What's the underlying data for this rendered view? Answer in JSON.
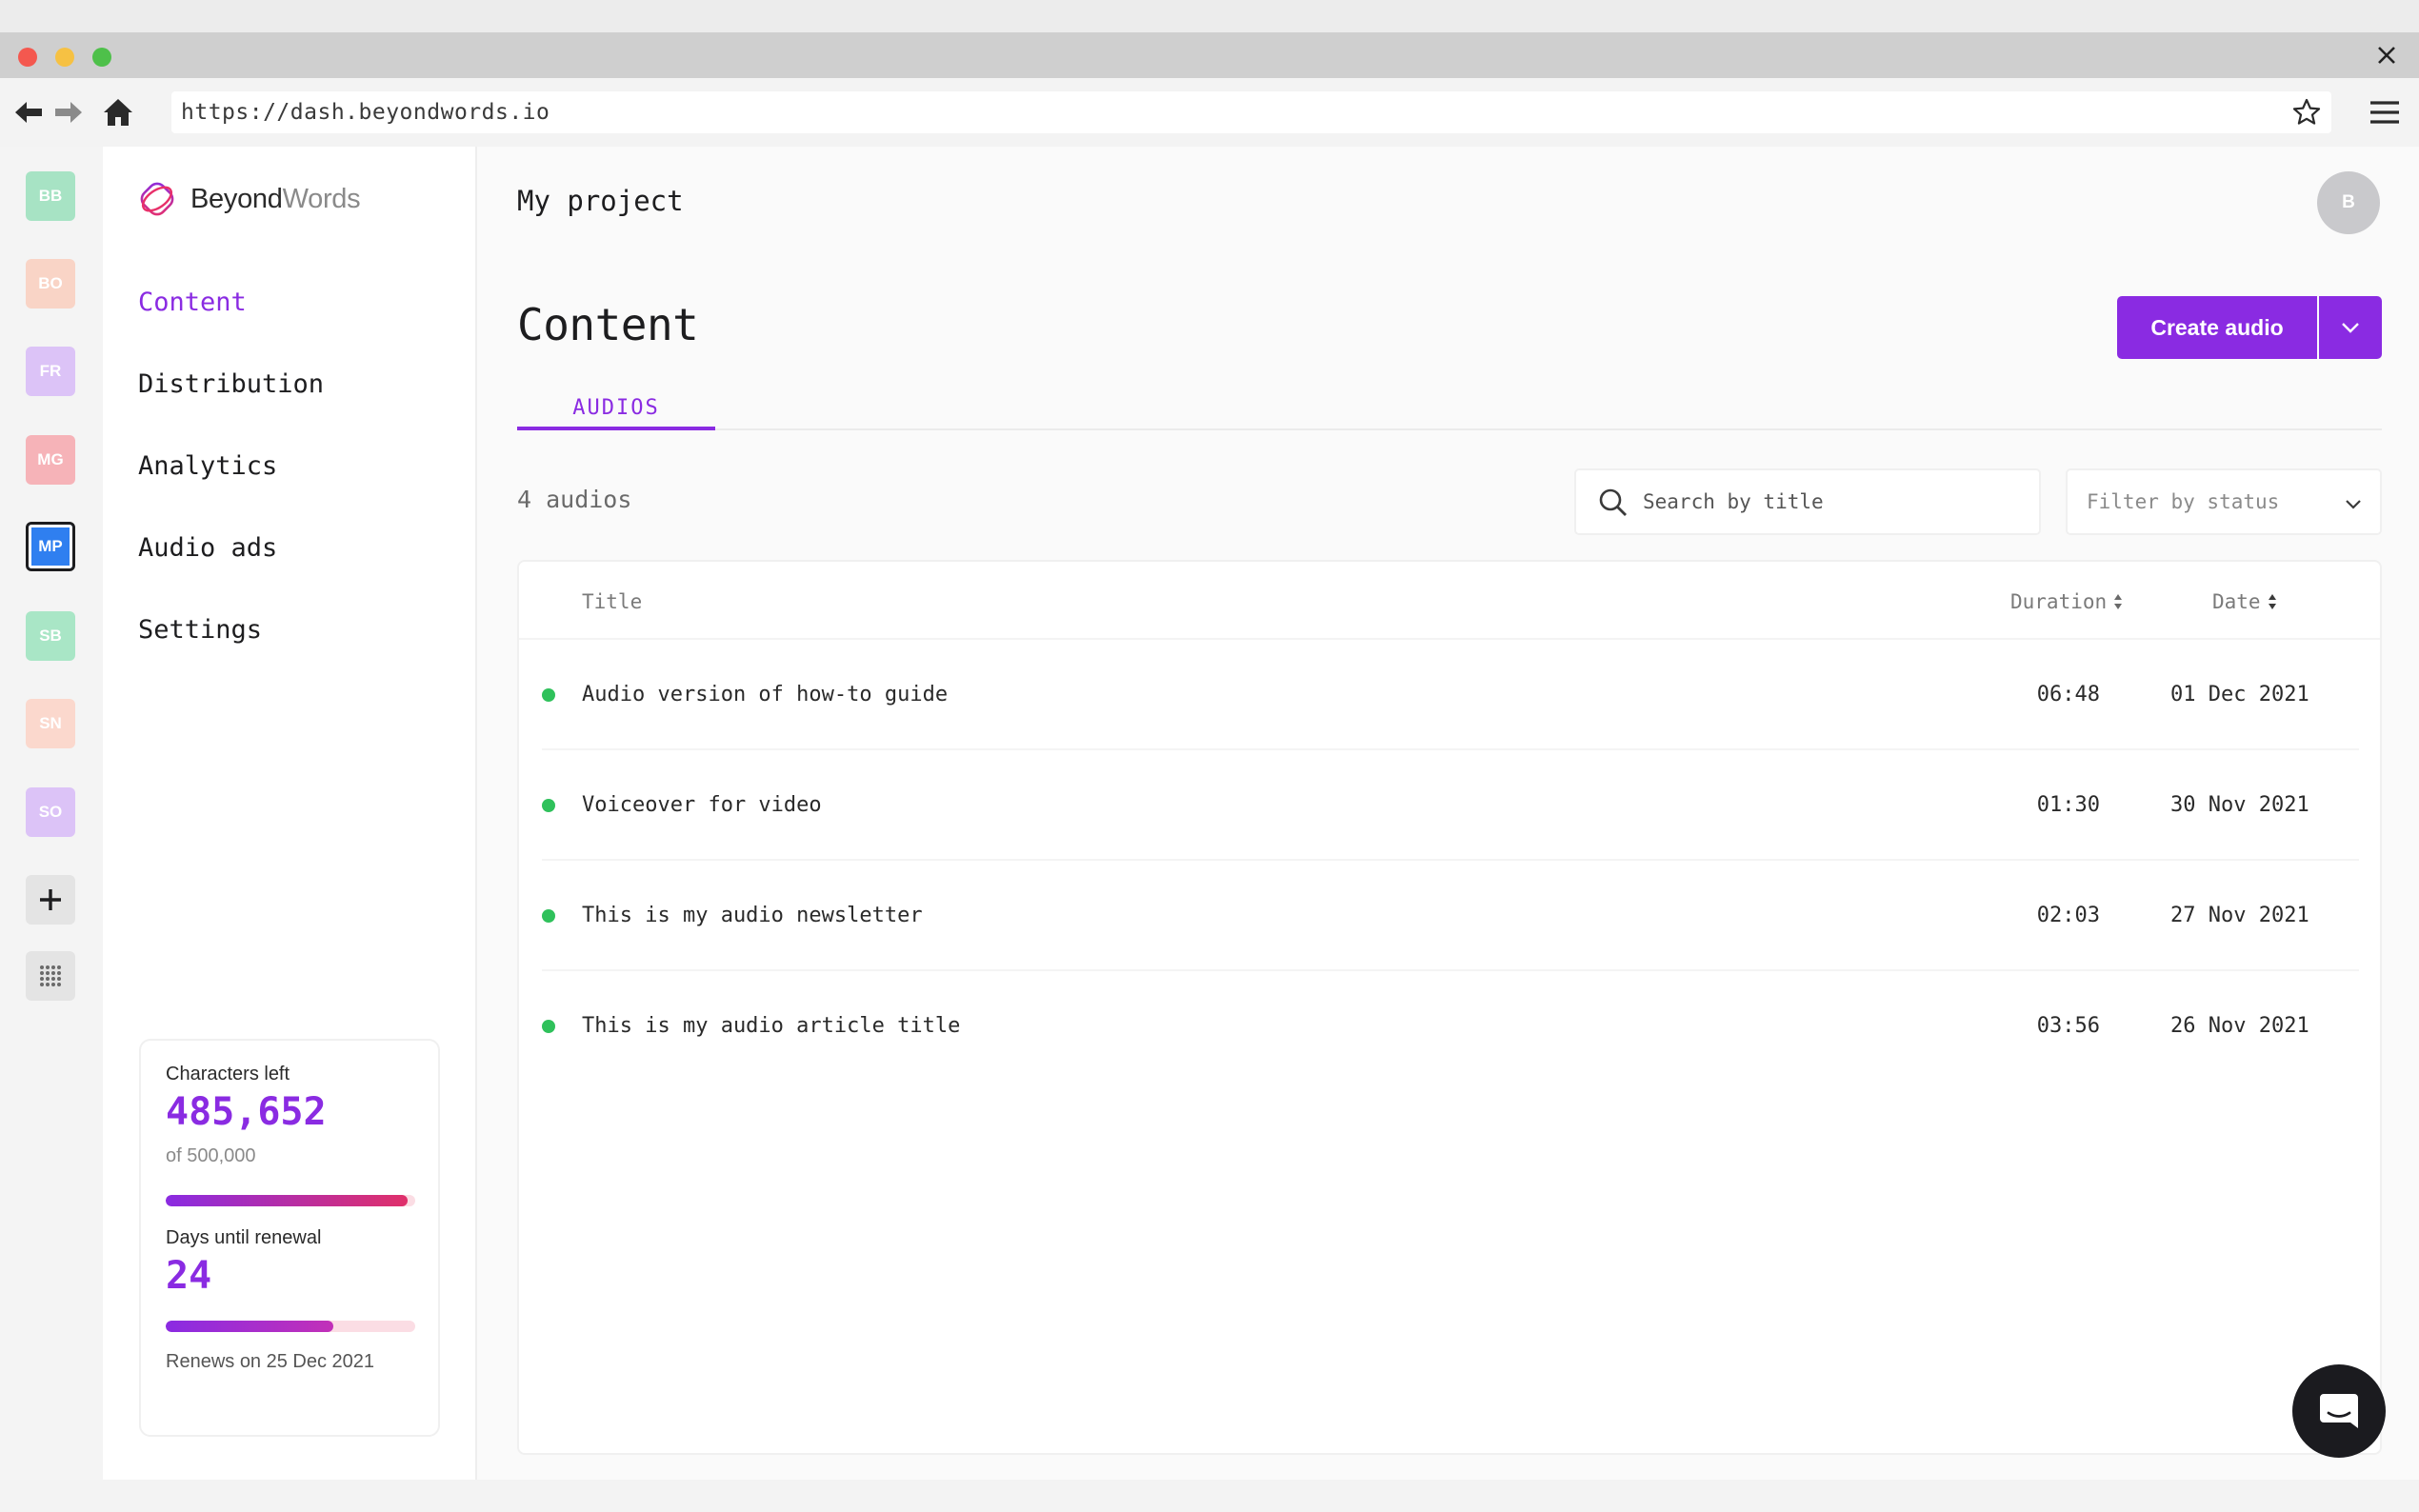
{
  "browser": {
    "url": "https://dash.beyondwords.io",
    "icons": {
      "back": "arrow-left-icon",
      "forward": "arrow-right-icon",
      "home": "home-icon",
      "bookmark": "star-icon",
      "menu": "hamburger-icon",
      "close": "close-icon"
    }
  },
  "workspaces": [
    {
      "initials": "BB",
      "color": "#a7e3c4"
    },
    {
      "initials": "BO",
      "color": "#f9d4c6"
    },
    {
      "initials": "FR",
      "color": "#dcc3f7"
    },
    {
      "initials": "MG",
      "color": "#f6b3b8"
    },
    {
      "initials": "MP",
      "color": "#2f7ff0",
      "active": true
    },
    {
      "initials": "SB",
      "color": "#a9e6c6"
    },
    {
      "initials": "SN",
      "color": "#fbd8cd"
    },
    {
      "initials": "SO",
      "color": "#dcc3f7"
    }
  ],
  "rail_actions": {
    "add_icon": "plus-icon",
    "apps_icon": "grid-dots-icon"
  },
  "brand": {
    "name_bold": "Beyond",
    "name_light": "Words",
    "logo_icon": "beyondwords-logo-icon"
  },
  "nav": [
    {
      "label": "Content",
      "active": true
    },
    {
      "label": "Distribution"
    },
    {
      "label": "Analytics"
    },
    {
      "label": "Audio ads"
    },
    {
      "label": "Settings"
    }
  ],
  "usage": {
    "chars_label": "Characters left",
    "chars_value": "485,652",
    "chars_total": "of 500,000",
    "chars_fraction": 0.971,
    "days_label": "Days until renewal",
    "days_value": "24",
    "days_fraction": 0.67,
    "renews": "Renews on 25 Dec 2021"
  },
  "header": {
    "project": "My project",
    "avatar_initial": "B"
  },
  "page": {
    "title": "Content",
    "create_label": "Create audio",
    "tab": "AUDIOS",
    "count": "4 audios",
    "search_placeholder": "Search by title",
    "filter_label": "Filter by status"
  },
  "table": {
    "columns": {
      "title": "Title",
      "duration": "Duration",
      "date": "Date"
    },
    "rows": [
      {
        "title": "Audio version of how-to guide",
        "duration": "06:48",
        "date": "01 Dec 2021",
        "status_color": "#2fc15b"
      },
      {
        "title": "Voiceover for video",
        "duration": "01:30",
        "date": "30 Nov 2021",
        "status_color": "#2fc15b"
      },
      {
        "title": "This is my audio newsletter",
        "duration": "02:03",
        "date": "27 Nov 2021",
        "status_color": "#2fc15b"
      },
      {
        "title": "This is my audio article title",
        "duration": "03:56",
        "date": "26 Nov 2021",
        "status_color": "#2fc15b"
      }
    ]
  },
  "colors": {
    "accent": "#8a2be2",
    "status_published": "#2fc15b"
  },
  "chat": {
    "icon": "chat-bubble-icon"
  }
}
